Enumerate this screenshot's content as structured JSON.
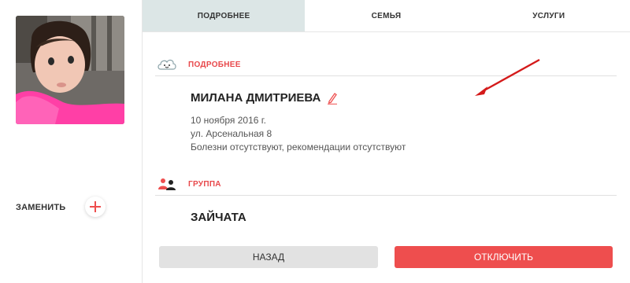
{
  "sidebar": {
    "replace_label": "ЗАМЕНИТЬ"
  },
  "tabs": [
    {
      "label": "ПОДРОБНЕЕ",
      "active": true
    },
    {
      "label": "СЕМЬЯ",
      "active": false
    },
    {
      "label": "УСЛУГИ",
      "active": false
    }
  ],
  "details_section": {
    "title": "ПОДРОБНЕЕ",
    "child_name": "МИЛАНА ДМИТРИЕВА",
    "birth_date": "10 ноября 2016 г.",
    "address": "ул. Арсенальная 8",
    "health_note": "Болезни отсутствуют, рекомендации отсутствуют"
  },
  "group_section": {
    "title": "ГРУППА",
    "group_name": "ЗАЙЧАТА"
  },
  "actions": {
    "back_label": "НАЗАД",
    "disconnect_label": "ОТКЛЮЧИТЬ"
  },
  "colors": {
    "accent_red": "#ee4e4e",
    "section_title_red": "#e8484b",
    "active_tab_bg": "#dce6e6",
    "back_button_bg": "#e2e2e2"
  },
  "icons": {
    "details": "cloud-face-icon",
    "group": "people-icon",
    "edit": "pencil-icon",
    "add": "plus-icon"
  }
}
